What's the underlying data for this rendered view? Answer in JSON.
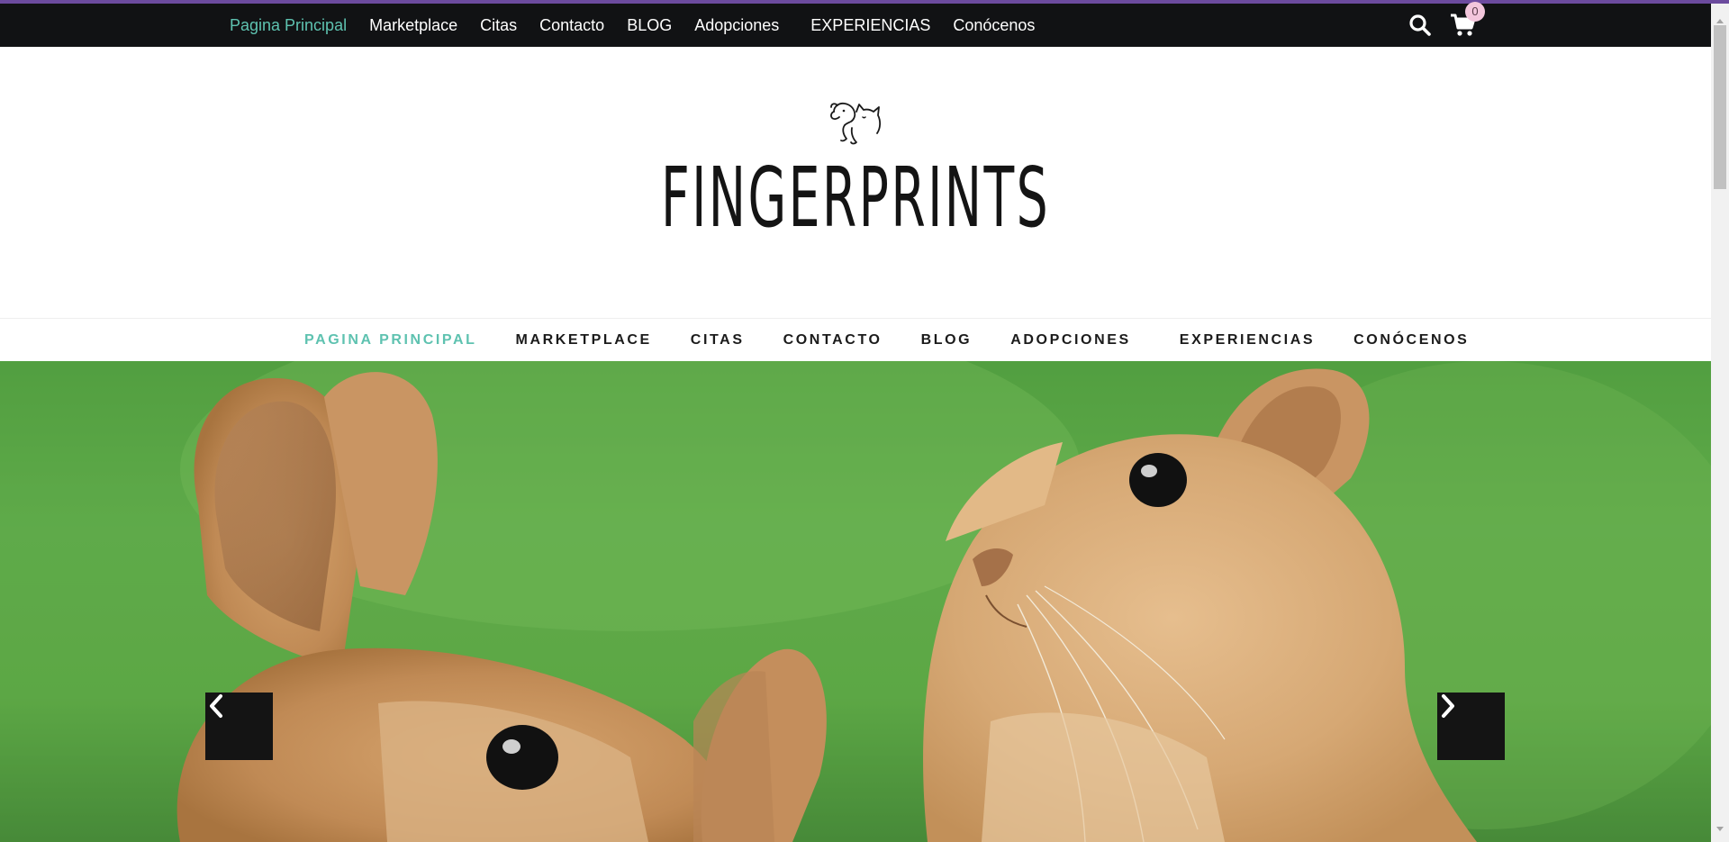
{
  "colors": {
    "topbar_bg": "#111214",
    "accent": "#5ec2b0",
    "badge_bg": "#f3c6dc",
    "arrow_bg": "#141414"
  },
  "top_nav": {
    "items": [
      {
        "label": "Pagina Principal",
        "active": true
      },
      {
        "label": "Marketplace"
      },
      {
        "label": "Citas"
      },
      {
        "label": "Contacto"
      },
      {
        "label": "BLOG"
      },
      {
        "label": "Adopciones"
      },
      {
        "label": "EXPERIENCIAS"
      },
      {
        "label": "Conócenos"
      }
    ],
    "search_icon": "search-icon",
    "cart_icon": "cart-icon",
    "cart_count": "0"
  },
  "logo": {
    "icon": "dog-cat-outline-icon",
    "text": "FINGERPRINTS"
  },
  "main_nav": {
    "items": [
      {
        "label": "PAGINA PRINCIPAL",
        "active": true
      },
      {
        "label": "MARKETPLACE"
      },
      {
        "label": "CITAS"
      },
      {
        "label": "CONTACTO"
      },
      {
        "label": "BLOG"
      },
      {
        "label": "ADOPCIONES"
      },
      {
        "label": "EXPERIENCIAS"
      },
      {
        "label": "CONÓCENOS"
      }
    ]
  },
  "hero": {
    "image": "rabbits-on-grass-photo",
    "prev_icon": "chevron-left-icon",
    "next_icon": "chevron-right-icon"
  }
}
